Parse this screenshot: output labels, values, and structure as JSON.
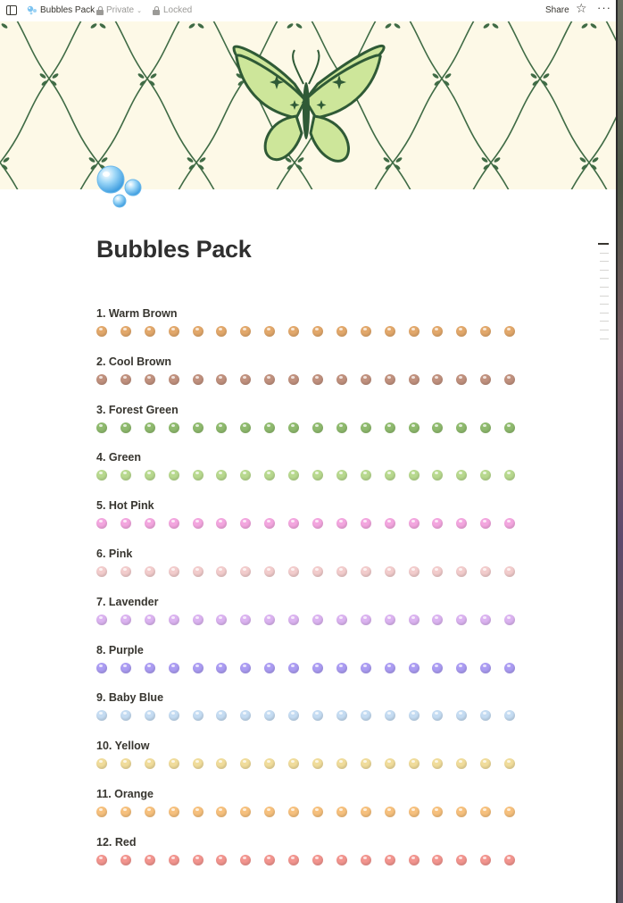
{
  "topbar": {
    "page_title": "Bubbles Pack",
    "visibility": "Private",
    "lock_state": "Locked",
    "share_label": "Share"
  },
  "icons": {
    "sidebar": "sidebar-toggle-icon",
    "page": "bubbles-icon",
    "favorite": "star-icon",
    "more": "more-icon",
    "lock": "lock-icon"
  },
  "page": {
    "title": "Bubbles Pack"
  },
  "colors": {
    "cover_background": "#fdf9e7",
    "cover_vine": "#3f6b45",
    "butterfly_fill": "#cde69a",
    "butterfly_stroke": "#2f5a36"
  },
  "sections": [
    {
      "title": "1. Warm Brown",
      "color": "#e2a86b",
      "count": 18
    },
    {
      "title": "2. Cool Brown",
      "color": "#c0917e",
      "count": 18
    },
    {
      "title": "3. Forest Green",
      "color": "#8fba6e",
      "count": 18
    },
    {
      "title": "4. Green",
      "color": "#b8d98f",
      "count": 18
    },
    {
      "title": "5. Hot Pink",
      "color": "#f3a6df",
      "count": 18
    },
    {
      "title": "6. Pink",
      "color": "#f2cccc",
      "count": 18
    },
    {
      "title": "7. Lavender",
      "color": "#dbb3f0",
      "count": 18
    },
    {
      "title": "8. Purple",
      "color": "#ab9cf2",
      "count": 18
    },
    {
      "title": "9. Baby Blue",
      "color": "#c5dcf2",
      "count": 18
    },
    {
      "title": "10. Yellow",
      "color": "#f0dc9b",
      "count": 18
    },
    {
      "title": "11. Orange",
      "color": "#f6c07d",
      "count": 18
    },
    {
      "title": "12. Red",
      "color": "#f2958f",
      "count": 18
    }
  ]
}
